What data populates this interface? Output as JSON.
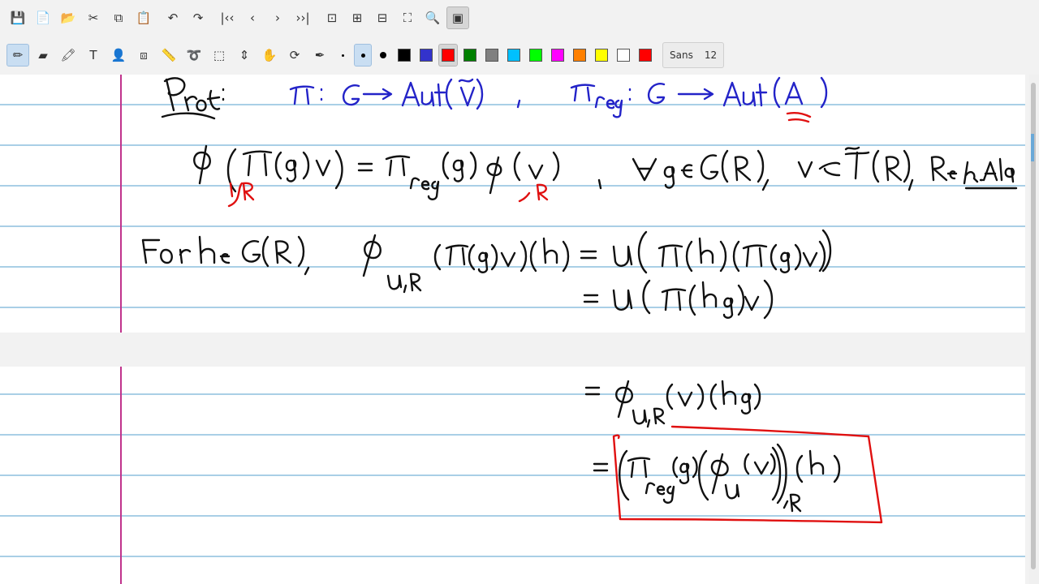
{
  "toolbar_top": {
    "buttons": [
      {
        "name": "save-button",
        "icon": "save-icon",
        "glyph": "💾"
      },
      {
        "name": "new-page-button",
        "icon": "new-file-icon",
        "glyph": "📄"
      },
      {
        "name": "open-button",
        "icon": "folder-icon",
        "glyph": "📂"
      },
      {
        "name": "cut-button",
        "icon": "scissors-icon",
        "glyph": "✂"
      },
      {
        "name": "copy-button",
        "icon": "copy-icon",
        "glyph": "⧉"
      },
      {
        "name": "paste-button",
        "icon": "clipboard-icon",
        "glyph": "📋"
      },
      {
        "name": "undo-button",
        "icon": "undo-icon",
        "glyph": "↶"
      },
      {
        "name": "redo-button",
        "icon": "redo-icon",
        "glyph": "↷"
      },
      {
        "name": "first-page-button",
        "icon": "first-page-icon",
        "glyph": "|‹‹"
      },
      {
        "name": "previous-page-button",
        "icon": "chevron-left-icon",
        "glyph": "‹"
      },
      {
        "name": "next-page-button",
        "icon": "chevron-right-icon",
        "glyph": "›"
      },
      {
        "name": "last-page-button",
        "icon": "last-page-icon",
        "glyph": "››|"
      },
      {
        "name": "zoom-fit-button",
        "icon": "zoom-fit-icon",
        "glyph": "⊡"
      },
      {
        "name": "zoom-width-button",
        "icon": "fit-width-icon",
        "glyph": "⊞"
      },
      {
        "name": "zoom-out-fit-button",
        "icon": "shrink-icon",
        "glyph": "⊟"
      },
      {
        "name": "fullscreen-button",
        "icon": "fullscreen-icon",
        "glyph": "⛶"
      },
      {
        "name": "zoom-button",
        "icon": "magnifier-icon",
        "glyph": "🔍"
      },
      {
        "name": "presentation-button",
        "icon": "presentation-icon",
        "glyph": "▣"
      }
    ]
  },
  "toolbar_tools": {
    "tools": [
      {
        "name": "pen-tool",
        "icon": "pencil-icon",
        "glyph": "✏",
        "active": true
      },
      {
        "name": "eraser-tool",
        "icon": "eraser-icon",
        "glyph": "▰"
      },
      {
        "name": "highlighter-tool",
        "icon": "highlighter-icon",
        "glyph": "🖍"
      },
      {
        "name": "text-tool",
        "icon": "text-icon",
        "glyph": "T"
      },
      {
        "name": "image-tool",
        "icon": "image-icon",
        "glyph": "👤"
      },
      {
        "name": "shape-tool",
        "icon": "shape-icon",
        "glyph": "⧈"
      },
      {
        "name": "ruler-tool",
        "icon": "ruler-icon",
        "glyph": "📏"
      },
      {
        "name": "lasso-select-tool",
        "icon": "lasso-icon",
        "glyph": "➰"
      },
      {
        "name": "rect-select-tool",
        "icon": "select-rect-icon",
        "glyph": "⬚"
      },
      {
        "name": "vertical-space-tool",
        "icon": "vertical-space-icon",
        "glyph": "⇕"
      },
      {
        "name": "hand-tool",
        "icon": "hand-icon",
        "glyph": "✋"
      },
      {
        "name": "default-tool",
        "icon": "refresh-icon",
        "glyph": "⟳"
      },
      {
        "name": "pen-settings-tool",
        "icon": "pen-settings-icon",
        "glyph": "✒"
      }
    ],
    "pen_sizes": [
      {
        "name": "pen-size-fine",
        "size": 3
      },
      {
        "name": "pen-size-medium",
        "size": 5,
        "selected": true
      },
      {
        "name": "pen-size-thick",
        "size": 8
      }
    ],
    "colors": [
      {
        "name": "color-black",
        "hex": "#000000"
      },
      {
        "name": "color-blue",
        "hex": "#3333cc"
      },
      {
        "name": "color-red",
        "hex": "#ff0000",
        "selected": true
      },
      {
        "name": "color-green",
        "hex": "#008000"
      },
      {
        "name": "color-gray",
        "hex": "#808080"
      },
      {
        "name": "color-light-blue",
        "hex": "#00c0ff"
      },
      {
        "name": "color-light-green",
        "hex": "#00ff00"
      },
      {
        "name": "color-magenta",
        "hex": "#ff00ff"
      },
      {
        "name": "color-orange",
        "hex": "#ff8000"
      },
      {
        "name": "color-yellow",
        "hex": "#ffff00"
      },
      {
        "name": "color-white",
        "hex": "#ffffff"
      },
      {
        "name": "color-current",
        "hex": "#ff0000"
      }
    ],
    "font_name": "Sans",
    "font_size": "12"
  },
  "notes": {
    "proof_label": "Proof :",
    "ink_colors": {
      "black": "#111111",
      "blue": "#2323c8",
      "red": "#e01010",
      "rule": "#a9cfe6",
      "margin": "#c0338c"
    }
  }
}
